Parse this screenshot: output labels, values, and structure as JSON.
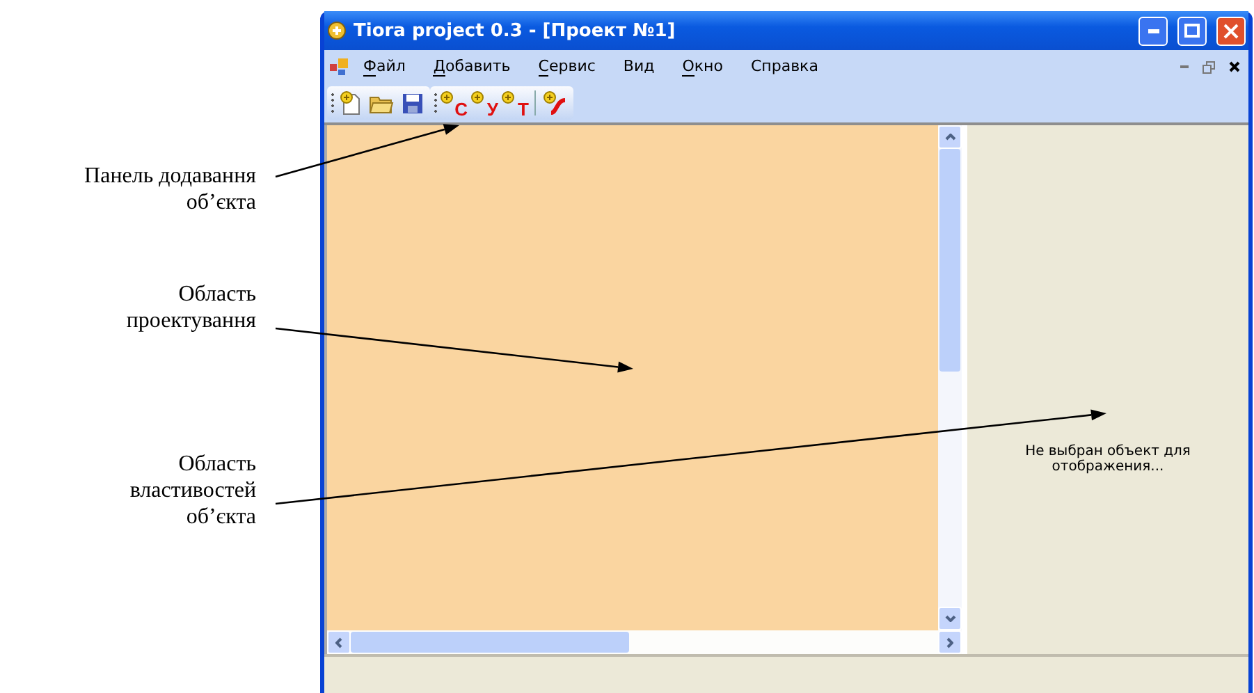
{
  "annotations": [
    {
      "text": "Панель додавання\nоб’єкта"
    },
    {
      "text": "Область\nпроектування"
    },
    {
      "text": "Область\nвластивостей\nоб’єкта"
    }
  ],
  "window": {
    "title": "Tiora project 0.3 - [Проект №1]"
  },
  "menu": [
    {
      "label": "Файл",
      "underlined_first": true
    },
    {
      "label": "Добавить",
      "underlined_first": true
    },
    {
      "label": "Сервис",
      "underlined_first": true
    },
    {
      "label": "Вид",
      "underlined_first": false
    },
    {
      "label": "Окно",
      "underlined_first": true
    },
    {
      "label": "Справка",
      "underlined_first": false
    }
  ],
  "toolbar": [
    [
      {
        "kind": "new"
      },
      {
        "kind": "open"
      },
      {
        "kind": "save"
      }
    ],
    [
      {
        "kind": "add",
        "glyph": "С"
      },
      {
        "kind": "add",
        "glyph": "У"
      },
      {
        "kind": "add",
        "glyph": "Т"
      }
    ],
    [
      {
        "kind": "curve"
      }
    ]
  ],
  "properties_panel": {
    "message": "Не выбран объект для\nотображения..."
  }
}
